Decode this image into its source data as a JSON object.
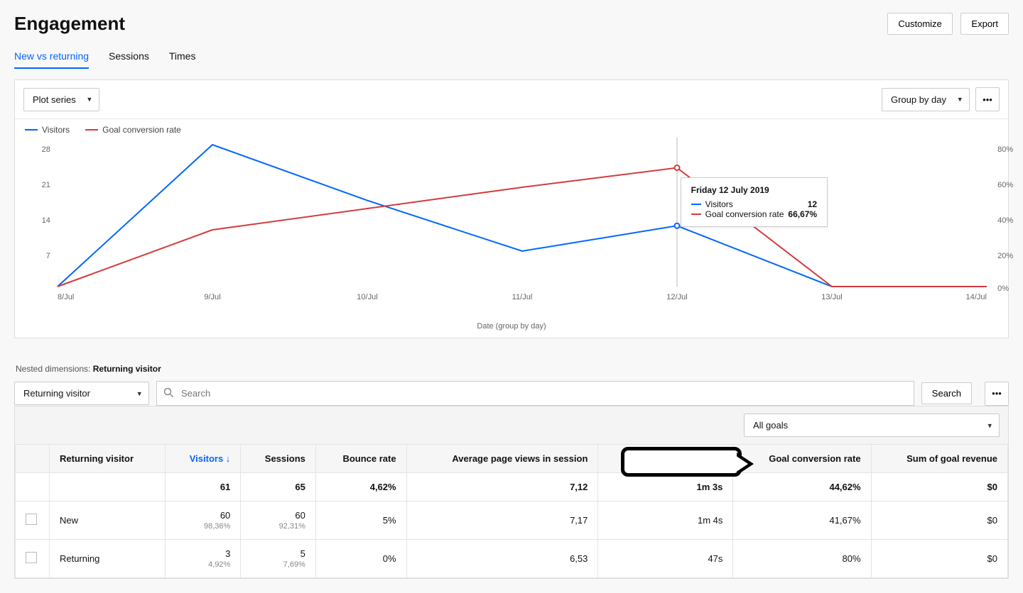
{
  "header": {
    "title": "Engagement",
    "customize": "Customize",
    "export": "Export"
  },
  "tabs": {
    "items": [
      "New vs returning",
      "Sessions",
      "Times"
    ],
    "active_index": 0
  },
  "chart_card": {
    "plot_series": "Plot series",
    "group_by": "Group by day",
    "legend": {
      "visitors": "Visitors",
      "conversion": "Goal conversion rate"
    },
    "xlabel": "Date (group by day)",
    "tooltip": {
      "title": "Friday 12 July 2019",
      "row1_label": "Visitors",
      "row1_value": "12",
      "row2_label": "Goal conversion rate",
      "row2_value": "66,67%"
    }
  },
  "chart_data": {
    "type": "line",
    "x": [
      "8/Jul",
      "9/Jul",
      "10/Jul",
      "11/Jul",
      "12/Jul",
      "13/Jul",
      "14/Jul"
    ],
    "series": [
      {
        "name": "Visitors",
        "axis": "left",
        "color": "#0066ff",
        "values": [
          0,
          28,
          17,
          7,
          12,
          0,
          0
        ]
      },
      {
        "name": "Goal conversion rate",
        "axis": "right",
        "color": "#d43b3b",
        "values": [
          0,
          32,
          44,
          56,
          67,
          0,
          0
        ]
      }
    ],
    "y_left": {
      "ticks": [
        7,
        14,
        21,
        28
      ],
      "min": 0,
      "max": 28
    },
    "y_right": {
      "ticks": [
        "0%",
        "20%",
        "40%",
        "60%",
        "80%"
      ],
      "min": 0,
      "max": 80
    },
    "xlabel": "Date (group by day)",
    "highlight_x_index": 4
  },
  "table_section": {
    "nested_label": "Nested dimensions:",
    "nested_value": "Returning visitor",
    "dimension_select": "Returning visitor",
    "search_placeholder": "Search",
    "search_button": "Search",
    "goals_select": "All goals",
    "columns": {
      "c0": "",
      "c1": "Returning visitor",
      "c2": "Visitors",
      "c3": "Sessions",
      "c4": "Bounce rate",
      "c5": "Average page views in session",
      "c6": "",
      "c7": "Goal conversion rate",
      "c8": "Sum of goal revenue"
    },
    "totals": {
      "visitors": "61",
      "sessions": "65",
      "bounce": "4,62%",
      "avg_pv": "7,12",
      "avg_time": "1m 3s",
      "conv": "44,62%",
      "revenue": "$0"
    },
    "rows": [
      {
        "label": "New",
        "visitors": "60",
        "visitors_pct": "98,36%",
        "sessions": "60",
        "sessions_pct": "92,31%",
        "bounce": "5%",
        "avg_pv": "7,17",
        "avg_time": "1m 4s",
        "conv": "41,67%",
        "revenue": "$0"
      },
      {
        "label": "Returning",
        "visitors": "3",
        "visitors_pct": "4,92%",
        "sessions": "5",
        "sessions_pct": "7,69%",
        "bounce": "0%",
        "avg_pv": "6,53",
        "avg_time": "47s",
        "conv": "80%",
        "revenue": "$0"
      }
    ]
  }
}
